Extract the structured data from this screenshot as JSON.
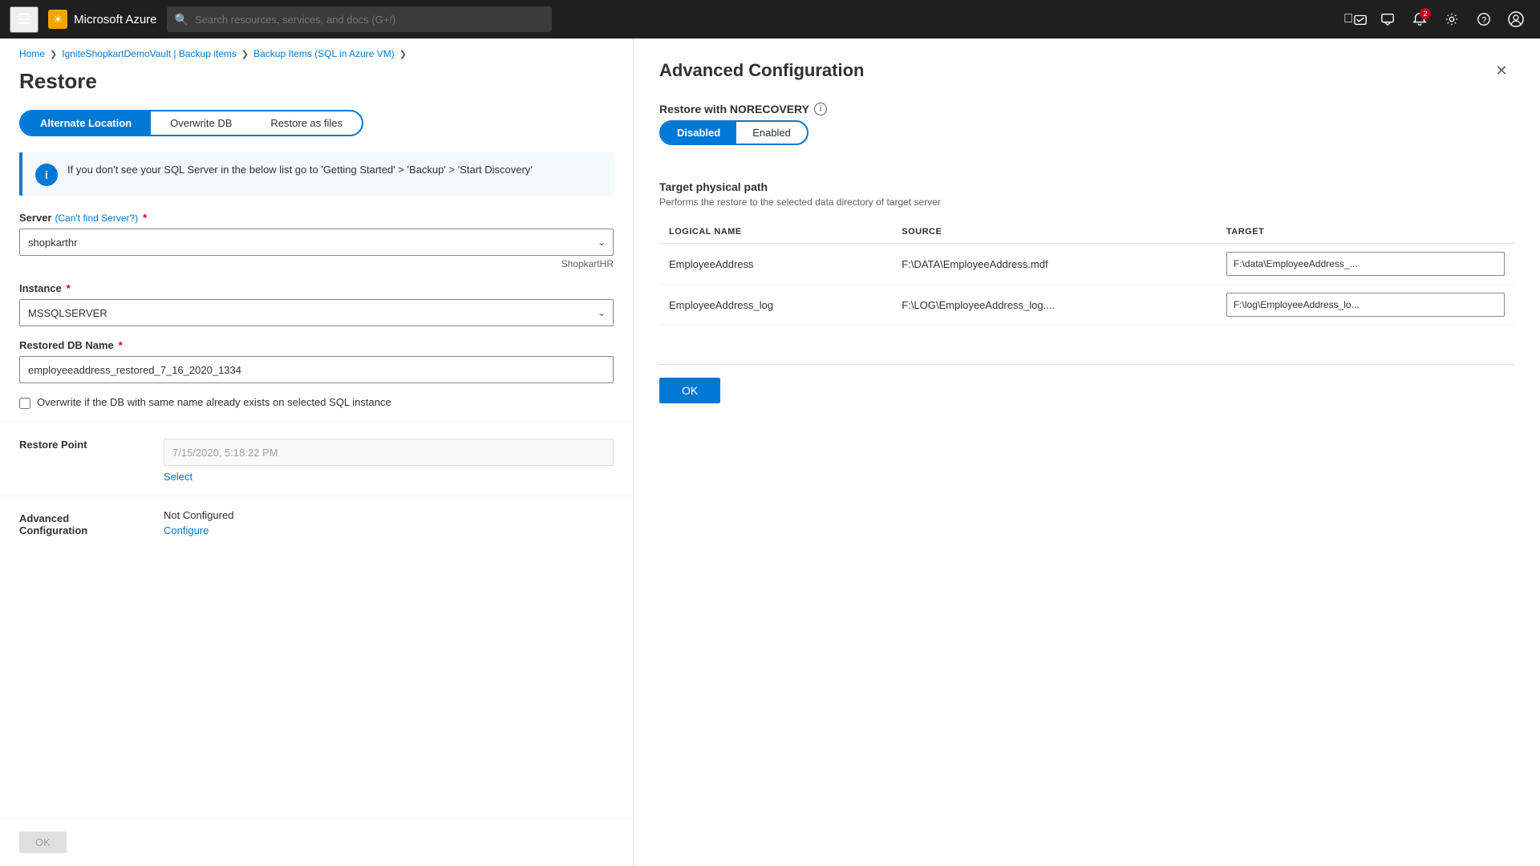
{
  "topbar": {
    "logo_text": "Microsoft Azure",
    "logo_icon": "☀",
    "search_placeholder": "Search resources, services, and docs (G+/)",
    "notification_count": "2"
  },
  "breadcrumb": {
    "items": [
      "Home",
      "IgniteShopkartDemoVault | Backup items",
      "Backup Items (SQL in Azure VM)"
    ]
  },
  "restore_page": {
    "title": "Restore",
    "tabs": [
      {
        "label": "Alternate Location",
        "active": true
      },
      {
        "label": "Overwrite DB",
        "active": false
      },
      {
        "label": "Restore as files",
        "active": false
      }
    ],
    "info_message": "If you don't see your SQL Server in the below list go to 'Getting Started' > 'Backup' > 'Start Discovery'",
    "server_label": "Server",
    "server_link": "Can't find Server?",
    "server_value": "shopkarthr",
    "server_hint": "ShopkartHR",
    "instance_label": "Instance",
    "instance_value": "MSSQLSERVER",
    "db_name_label": "Restored DB Name",
    "db_name_value": "employeeaddress_restored_7_16_2020_1334",
    "overwrite_checkbox_label": "Overwrite if the DB with same name already exists on selected SQL instance",
    "restore_point_label": "Restore Point",
    "restore_point_value": "7/15/2020, 5:18:22 PM",
    "restore_point_link": "Select",
    "adv_config_label": "Advanced Configuration",
    "adv_config_status": "Not Configured",
    "adv_config_link": "Configure",
    "ok_button": "OK"
  },
  "advanced_config": {
    "title": "Advanced Configuration",
    "norecovery_label": "Restore with NORECOVERY",
    "norecovery_disabled": "Disabled",
    "norecovery_enabled": "Enabled",
    "target_path_title": "Target physical path",
    "target_path_desc": "Performs the restore to the selected data directory of target server",
    "table_headers": [
      "LOGICAL NAME",
      "SOURCE",
      "TARGET"
    ],
    "table_rows": [
      {
        "logical_name": "EmployeeAddress",
        "source": "F:\\DATA\\EmployeeAddress.mdf",
        "target": "F:\\data\\EmployeeAddress_..."
      },
      {
        "logical_name": "EmployeeAddress_log",
        "source": "F:\\LOG\\EmployeeAddress_log....",
        "target": "F:\\log\\EmployeeAddress_lo..."
      }
    ],
    "ok_button": "OK"
  }
}
